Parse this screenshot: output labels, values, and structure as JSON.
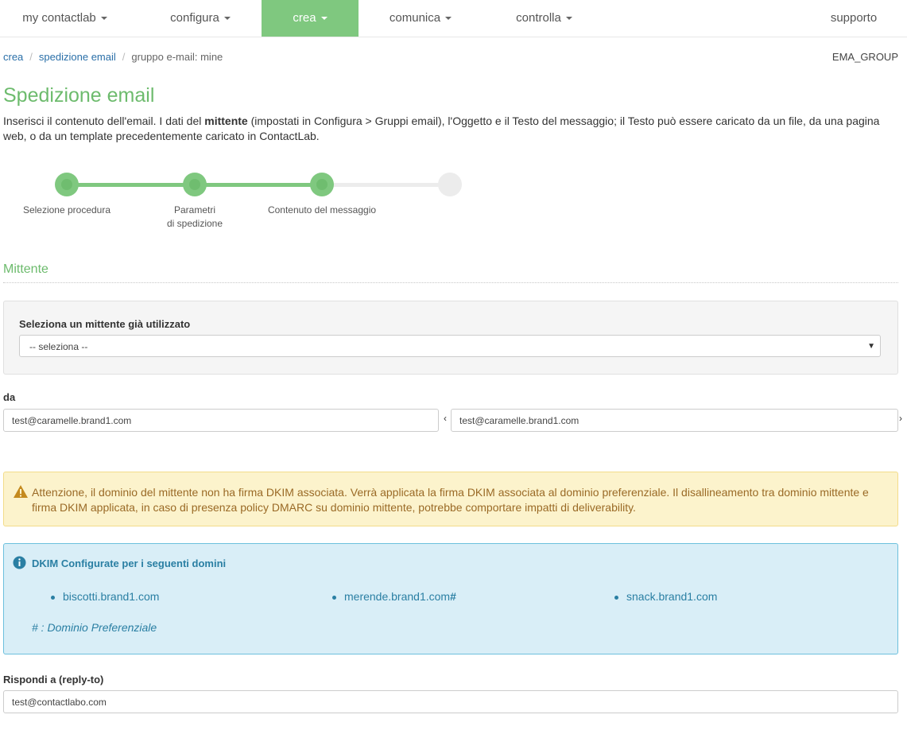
{
  "nav": {
    "items": [
      {
        "label": "my contactlab",
        "dropdown": true,
        "active": false
      },
      {
        "label": "configura",
        "dropdown": true,
        "active": false
      },
      {
        "label": "crea",
        "dropdown": true,
        "active": true
      },
      {
        "label": "comunica",
        "dropdown": true,
        "active": false
      },
      {
        "label": "controlla",
        "dropdown": true,
        "active": false
      }
    ],
    "support": "supporto",
    "active_color": "#7fc87f"
  },
  "breadcrumb": {
    "items": [
      "crea",
      "spedizione email"
    ],
    "current": "gruppo e-mail: mine"
  },
  "group_tag": "EMA_GROUP",
  "page": {
    "title": "Spedizione email",
    "intro_before": "Inserisci il contenuto dell'email. I dati del ",
    "intro_bold": "mittente",
    "intro_after": " (impostati in Configura > Gruppi email), l'Oggetto e il Testo del messaggio; il Testo può essere caricato da un file, da una pagina web, o da un template precedentemente caricato in ContactLab."
  },
  "stepper": {
    "steps": [
      {
        "label_line1": "Selezione procedura",
        "label_line2": "",
        "done": true
      },
      {
        "label_line1": "Parametri",
        "label_line2": "di spedizione",
        "done": true
      },
      {
        "label_line1": "Contenuto del messaggio",
        "label_line2": "",
        "done": true
      },
      {
        "label_line1": "",
        "label_line2": "",
        "done": false
      }
    ]
  },
  "sender_section": {
    "title": "Mittente",
    "select_label": "Seleziona un mittente già utilizzato",
    "select_value": "-- seleziona --",
    "from_label": "da",
    "from_value_left": "test@caramelle.brand1.com",
    "from_value_right": "test@caramelle.brand1.com"
  },
  "warning": {
    "icon": "warning-triangle-icon",
    "text": "Attenzione, il dominio del mittente non ha firma DKIM associata. Verrà applicata la firma DKIM associata al dominio preferenziale. Il disallineamento tra dominio mittente e firma DKIM applicata, in caso di presenza policy DMARC su dominio mittente, potrebbe comportare impatti di deliverability."
  },
  "dkim_info": {
    "icon": "info-circle-icon",
    "heading": "DKIM Configurate per i seguenti domini",
    "domains": [
      {
        "name": "biscotti.brand1.com",
        "marker": ""
      },
      {
        "name": "merende.brand1.com",
        "marker": "#"
      },
      {
        "name": "snack.brand1.com",
        "marker": ""
      }
    ],
    "note": "# : Dominio Preferenziale"
  },
  "reply_to": {
    "label": "Rispondi a (reply-to)",
    "value": "test@contactlabo.com"
  },
  "colors": {
    "accent_green": "#6dbb6d",
    "link_blue": "#2a6fa8",
    "warning_bg": "#fcf3cc",
    "info_bg": "#d9eef7"
  }
}
